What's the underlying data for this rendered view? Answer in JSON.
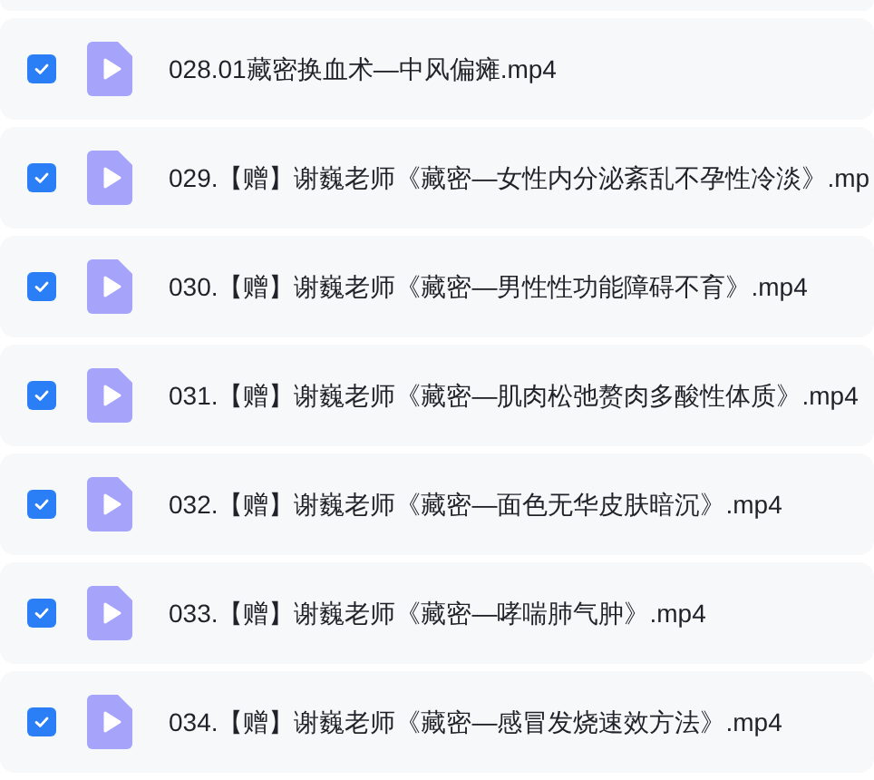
{
  "files": [
    {
      "name": "028.01藏密换血术—中风偏瘫.mp4",
      "checked": true
    },
    {
      "name": "029.【赠】谢巍老师《藏密—女性内分泌紊乱不孕性冷淡》.mp",
      "checked": true
    },
    {
      "name": "030.【赠】谢巍老师《藏密—男性性功能障碍不育》.mp4",
      "checked": true
    },
    {
      "name": "031.【赠】谢巍老师《藏密—肌肉松弛赘肉多酸性体质》.mp4",
      "checked": true
    },
    {
      "name": "032.【赠】谢巍老师《藏密—面色无华皮肤暗沉》.mp4",
      "checked": true
    },
    {
      "name": "033.【赠】谢巍老师《藏密—哮喘肺气肿》.mp4",
      "checked": true
    },
    {
      "name": "034.【赠】谢巍老师《藏密—感冒发烧速效方法》.mp4",
      "checked": true
    }
  ]
}
